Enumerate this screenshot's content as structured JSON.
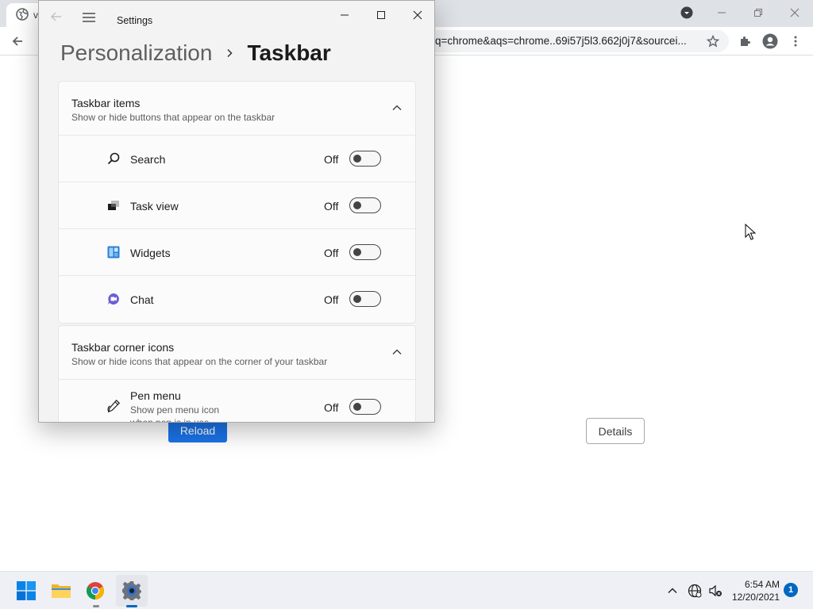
{
  "chrome": {
    "tab_title": "v",
    "omnibox_text": "q=chrome&aqs=chrome..69i57j5l3.662j0j7&sourcei...",
    "reload_label": "Reload",
    "details_label": "Details"
  },
  "settings": {
    "window_title": "Settings",
    "breadcrumb_parent": "Personalization",
    "breadcrumb_current": "Taskbar",
    "taskbar_items": {
      "title": "Taskbar items",
      "subtitle": "Show or hide buttons that appear on the taskbar",
      "rows": [
        {
          "label": "Search",
          "state": "Off",
          "icon": "search-icon"
        },
        {
          "label": "Task view",
          "state": "Off",
          "icon": "task-view-icon"
        },
        {
          "label": "Widgets",
          "state": "Off",
          "icon": "widgets-icon"
        },
        {
          "label": "Chat",
          "state": "Off",
          "icon": "chat-icon"
        }
      ]
    },
    "corner_icons": {
      "title": "Taskbar corner icons",
      "subtitle": "Show or hide icons that appear on the corner of your taskbar",
      "pen_menu": {
        "label": "Pen menu",
        "description": "Show pen menu icon when pen is in use",
        "state": "Off",
        "icon": "pen-icon"
      }
    }
  },
  "taskbar": {
    "time": "6:54 AM",
    "date": "12/20/2021",
    "notification_count": "1"
  },
  "colors": {
    "accent": "#0067c0",
    "chrome_button": "#1a73e8"
  }
}
